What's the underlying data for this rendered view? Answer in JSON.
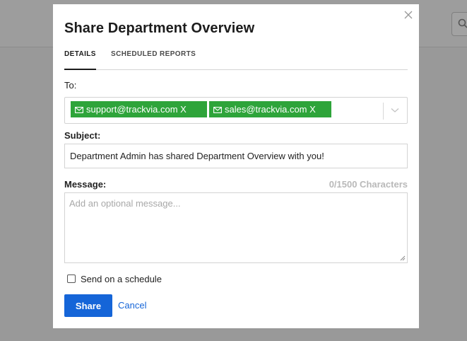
{
  "modal": {
    "title": "Share Department Overview",
    "tabs": [
      {
        "label": "DETAILS",
        "active": true
      },
      {
        "label": "SCHEDULED REPORTS",
        "active": false
      }
    ],
    "to": {
      "label": "To:",
      "recipients": [
        {
          "label": "support@trackvia.com X",
          "icon": "mail-icon"
        },
        {
          "label": "sales@trackvia.com X",
          "icon": "mail-icon"
        }
      ]
    },
    "subject": {
      "label": "Subject:",
      "value": "Department Admin has shared Department Overview with you!"
    },
    "message": {
      "label": "Message:",
      "counter": "0/1500 Characters",
      "placeholder": "Add an optional message...",
      "value": ""
    },
    "schedule": {
      "label": "Send on a schedule",
      "checked": false
    },
    "actions": {
      "share_label": "Share",
      "cancel_label": "Cancel"
    }
  },
  "colors": {
    "accent": "#1565d8",
    "chip": "#2ea43a",
    "backdrop": "#9a9a9a"
  }
}
